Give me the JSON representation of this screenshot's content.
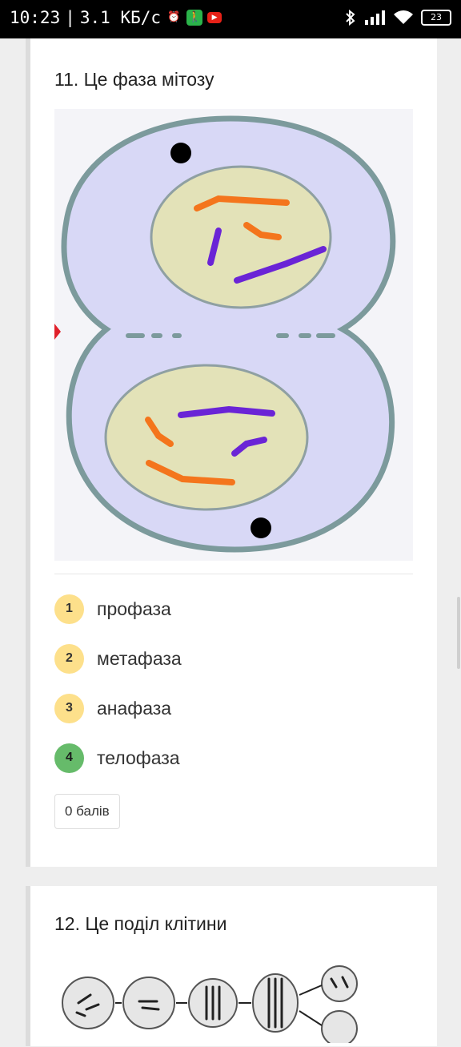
{
  "status_bar": {
    "time": "10:23",
    "speed": "3.1 КБ/с",
    "battery": "23",
    "icons": [
      "alarm-icon",
      "accessibility-icon",
      "youtube-icon",
      "bluetooth-icon",
      "signal-icon",
      "wifi-icon",
      "battery-icon"
    ]
  },
  "question1": {
    "title": "11. Це фаза мітозу",
    "options": [
      {
        "num": "1",
        "label": "профаза",
        "correct": false
      },
      {
        "num": "2",
        "label": "метафаза",
        "correct": false
      },
      {
        "num": "3",
        "label": "анафаза",
        "correct": false
      },
      {
        "num": "4",
        "label": "телофаза",
        "correct": true
      }
    ],
    "points": "0 балів"
  },
  "question2": {
    "title": "12. Це поділ клітини"
  },
  "colors": {
    "cell_fill": "#d8d8f6",
    "cell_border": "#7c9a9c",
    "nucleus_fill": "#e3e2b8",
    "chrom_orange": "#f4751c",
    "chrom_purple": "#6a24d6",
    "badge_yellow": "#fde08b",
    "badge_green": "#66bb6a"
  }
}
